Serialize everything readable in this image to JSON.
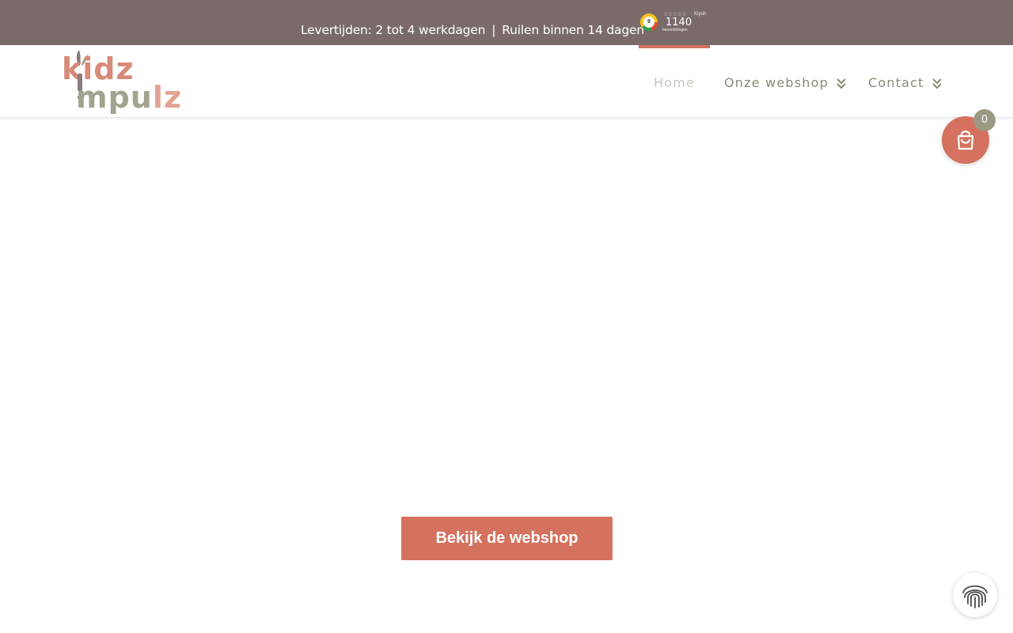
{
  "topbar": {
    "delivery": "Levertijden: 2 tot 4 werkdagen",
    "separator": "|",
    "returns": "Ruilen binnen 14 dagen",
    "kiyoh": {
      "score": "9",
      "stars": "☆☆☆☆☆",
      "brand": "Kiyoh",
      "count": "1140",
      "label": "beoordelingen"
    }
  },
  "logo": {
    "line1": "kidz",
    "line2_prefix": "mpu",
    "line2_suffix": "lz"
  },
  "nav": {
    "items": [
      {
        "label": "Home"
      },
      {
        "label": "Onze webshop"
      },
      {
        "label": "Contact"
      }
    ]
  },
  "cart": {
    "count": "0"
  },
  "cta": {
    "label": "Bekijk de webshop"
  },
  "colors": {
    "topbar": "#7a6b6a",
    "accent": "#d4725f",
    "nav_text": "#8b8874",
    "badge": "#9b9884"
  }
}
